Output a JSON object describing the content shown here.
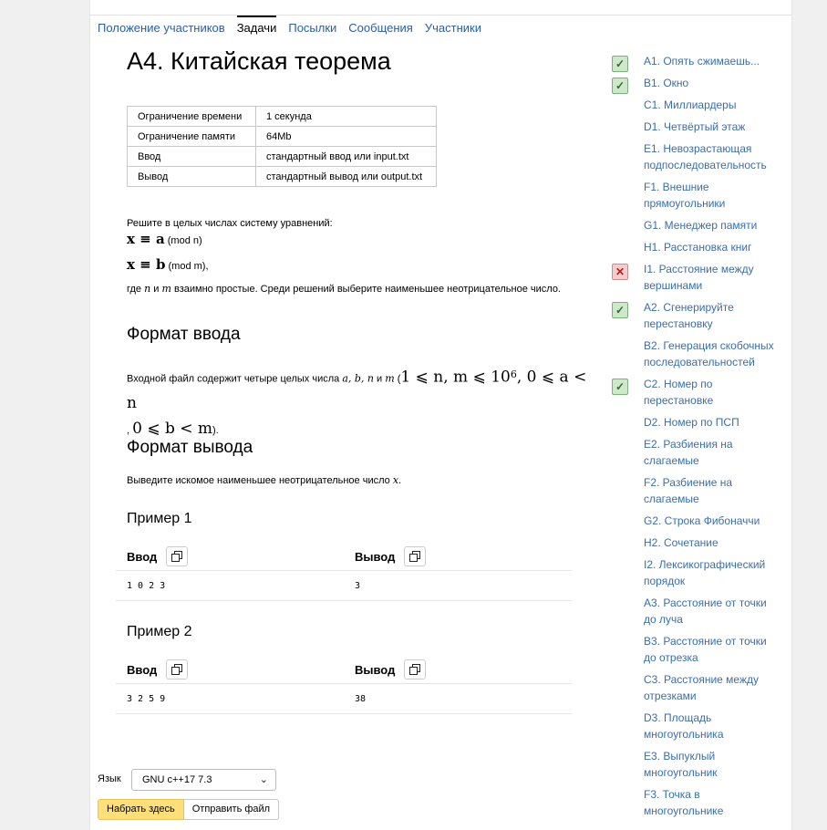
{
  "tabs": [
    "Положение участников",
    "Задачи",
    "Посылки",
    "Сообщения",
    "Участники"
  ],
  "problem": {
    "title": "A4. Китайская теорема",
    "limits": [
      {
        "k": "Ограничение времени",
        "v": "1 секунда"
      },
      {
        "k": "Ограничение памяти",
        "v": "64Mb"
      },
      {
        "k": "Ввод",
        "v": "стандартный ввод или input.txt"
      },
      {
        "k": "Вывод",
        "v": "стандартный вывод или output.txt"
      }
    ],
    "statement_line1": "Решите в целых числах систему уравнений:",
    "eq1": "x ≡ a",
    "eq1_mod": "(mod n)",
    "eq2": "x ≡ b",
    "eq2_mod": "(mod m),",
    "statement_line2_pre": "где ",
    "var_n": "n",
    "and": " и ",
    "var_m": "m",
    "statement_line2_post": " взаимно простые. Среди решений выберите наименьшее неотрицательное число.",
    "input_heading": "Формат ввода",
    "input_text_pre": "Входной файл содержит четыре целых числа ",
    "input_vars": "a, b, n",
    "input_and": " и ",
    "input_var_m": "m",
    "input_paren": " (",
    "input_cond1": "1 ⩽ n, m ⩽ 10",
    "input_exp": "6",
    "input_cond2": ", 0 ⩽ a < n",
    "input_cond3_pre": ", ",
    "input_cond3": "0 ⩽ b < m",
    "input_end": ").",
    "output_heading": "Формат вывода",
    "output_text_pre": "Выведите искомое наименьшее неотрицательное число ",
    "output_var": "x",
    "output_end": ".",
    "examples": [
      {
        "title": "Пример 1",
        "in_label": "Ввод",
        "out_label": "Вывод",
        "input": "1 0 2 3",
        "output": "3"
      },
      {
        "title": "Пример 2",
        "in_label": "Ввод",
        "out_label": "Вывод",
        "input": "3 2 5 9",
        "output": "38"
      }
    ]
  },
  "sidebar": [
    {
      "label": "A1. Опять сжимаешь...",
      "status": "ok"
    },
    {
      "label": "B1. Окно",
      "status": "ok"
    },
    {
      "label": "C1. Миллиардеры",
      "status": ""
    },
    {
      "label": "D1. Четвёртый этаж",
      "status": ""
    },
    {
      "label": "E1. Невозрастающая подпоследовательность",
      "status": ""
    },
    {
      "label": "F1. Внешние прямоугольники",
      "status": ""
    },
    {
      "label": "G1. Менеджер памяти",
      "status": ""
    },
    {
      "label": "H1. Расстановка книг",
      "status": ""
    },
    {
      "label": "I1. Расстояние между вершинами",
      "status": "fail"
    },
    {
      "label": "A2. Сгенерируйте перестановку",
      "status": "ok"
    },
    {
      "label": "B2. Генерация скобочных последовательностей",
      "status": ""
    },
    {
      "label": "C2. Номер по перестановке",
      "status": "ok"
    },
    {
      "label": "D2. Номер по ПСП",
      "status": ""
    },
    {
      "label": "E2. Разбиения на слагаемые",
      "status": ""
    },
    {
      "label": "F2. Разбиение на слагаемые",
      "status": ""
    },
    {
      "label": "G2. Строка Фибоначчи",
      "status": ""
    },
    {
      "label": "H2. Сочетание",
      "status": ""
    },
    {
      "label": "I2. Лексикографический порядок",
      "status": ""
    },
    {
      "label": "A3. Расстояние от точки до луча",
      "status": ""
    },
    {
      "label": "B3. Расстояние от точки до отрезка",
      "status": ""
    },
    {
      "label": "C3. Расстояние между отрезками",
      "status": ""
    },
    {
      "label": "D3. Площадь многоугольника",
      "status": ""
    },
    {
      "label": "E3. Выпуклый многоугольник",
      "status": ""
    },
    {
      "label": "F3. Точка в многоугольнике",
      "status": ""
    }
  ],
  "submit": {
    "lang_label": "Язык",
    "lang_value": "GNU c++17 7.3",
    "type_here": "Набрать здесь",
    "send_file": "Отправить файл"
  }
}
